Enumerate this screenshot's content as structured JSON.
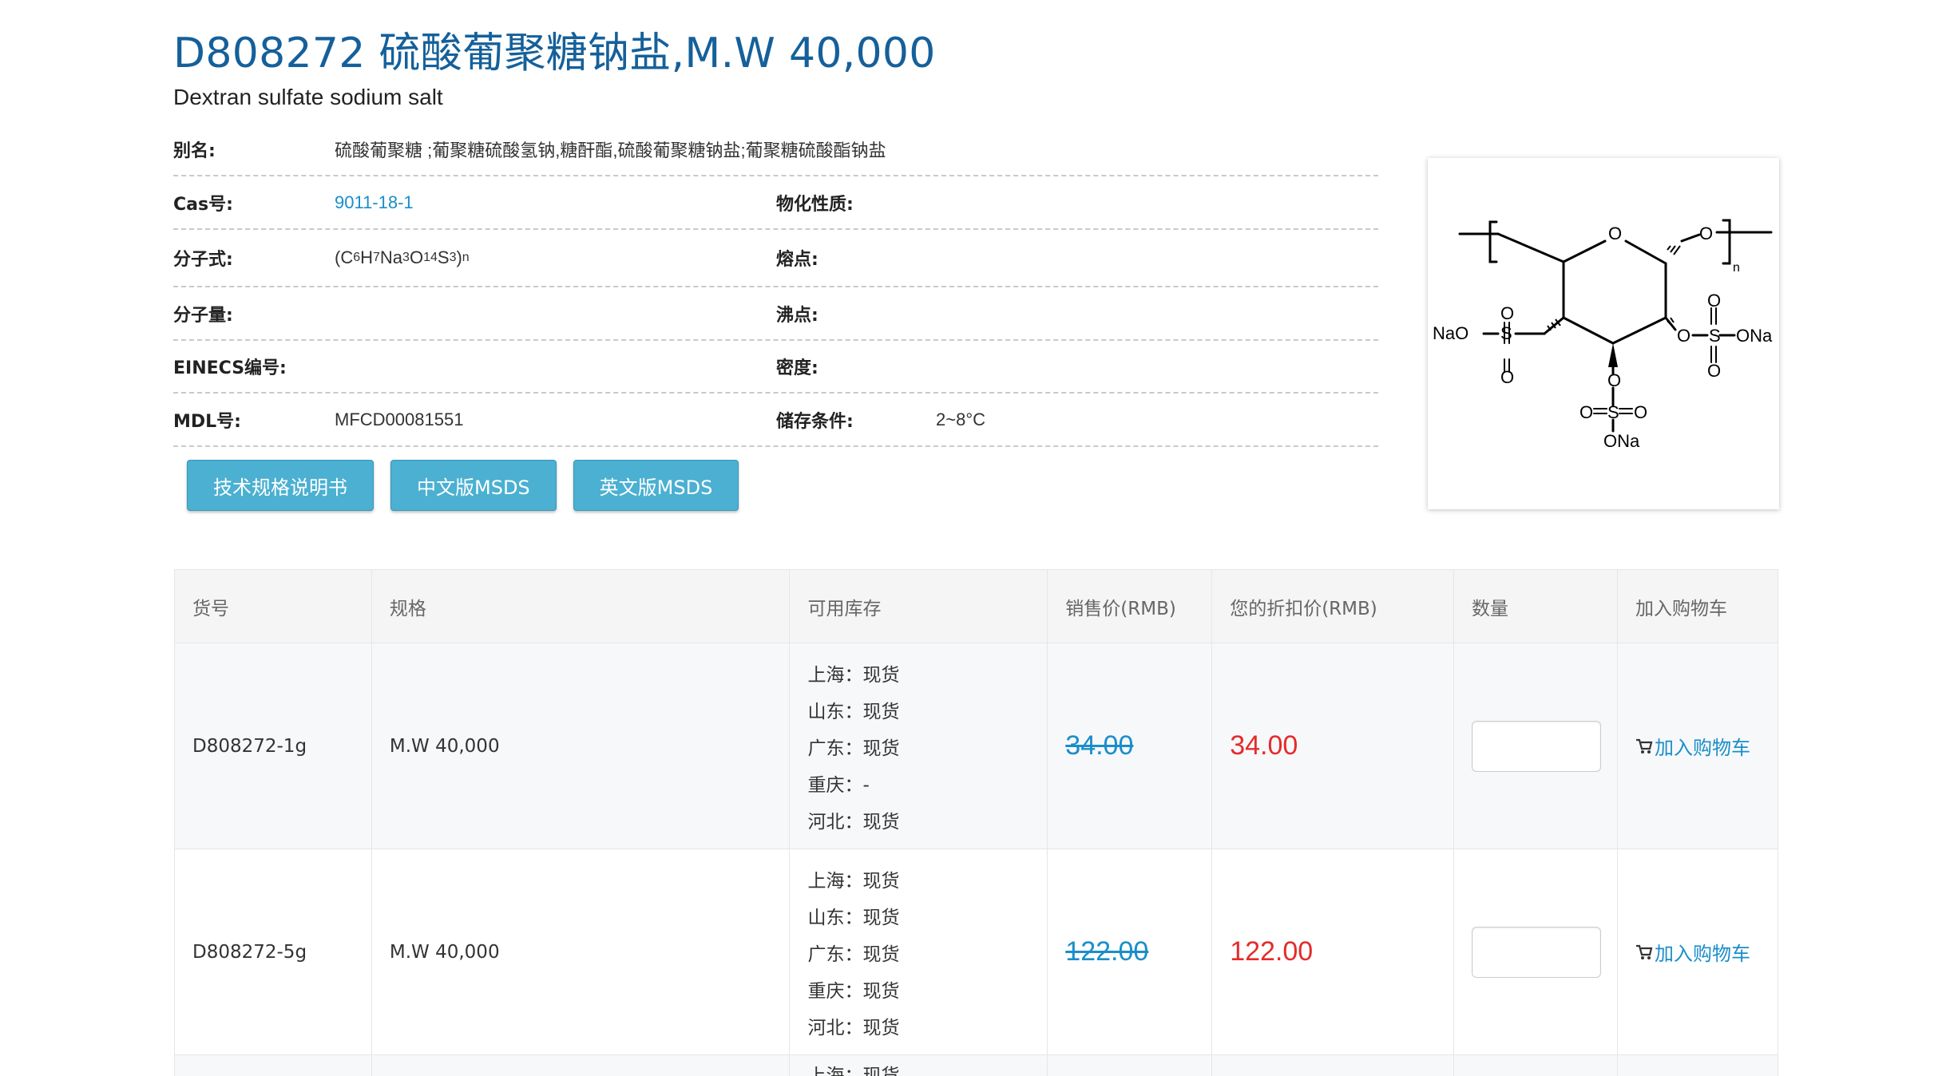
{
  "product": {
    "title": "D808272 硫酸葡聚糖钠盐,M.W 40,000",
    "subtitle": "Dextran sulfate sodium salt"
  },
  "properties": {
    "alias_label": "别名:",
    "alias_value": "硫酸葡聚糖 ;葡聚糖硫酸氢钠,糖酐酯,硫酸葡聚糖钠盐;葡聚糖硫酸酯钠盐",
    "cas_label": "Cas号:",
    "cas_value": "9011-18-1",
    "physchem_label": "物化性质:",
    "formula_label": "分子式:",
    "melting_label": "熔点:",
    "mw_label": "分子量:",
    "boiling_label": "沸点:",
    "einecs_label": "EINECS编号:",
    "density_label": "密度:",
    "mdl_label": "MDL号:",
    "mdl_value": "MFCD00081551",
    "storage_label": "储存条件:",
    "storage_value": "2~8°C"
  },
  "formula": {
    "p1": "(C",
    "s1": "6",
    "p2": "H",
    "s2": "7",
    "p3": "Na",
    "s3": "3",
    "p4": "O",
    "s4": "14",
    "p5": "S",
    "s5": "3",
    "p6": ")",
    "s6": "n"
  },
  "buttons": {
    "spec": "技术规格说明书",
    "msds_cn": "中文版MSDS",
    "msds_en": "英文版MSDS"
  },
  "structure_labels": {
    "ring_o": "O",
    "link_o": "O",
    "n": "n",
    "nao": "NaO",
    "s_left": "S",
    "o_top_left": "O",
    "o_bot_left": "O",
    "o_right_link": "O",
    "s_right": "S",
    "ona_right": "ONa",
    "o_top_right": "O",
    "o_bot_right": "O",
    "o_bottom_link": "O",
    "s_bottom": "S",
    "o_bl": "O",
    "o_br": "O",
    "ona_bottom": "ONa"
  },
  "table": {
    "headers": [
      "货号",
      "规格",
      "可用库存",
      "销售价(RMB)",
      "您的折扣价(RMB)",
      "数量",
      "加入购物车"
    ],
    "rows": [
      {
        "sku": "D808272-1g",
        "spec": "M.W 40,000",
        "stock": [
          "上海：现货",
          "山东：现货",
          "广东：现货",
          "重庆：-",
          "河北：现货"
        ],
        "price": "34.00",
        "discount": "34.00",
        "cart": "加入购物车"
      },
      {
        "sku": "D808272-5g",
        "spec": "M.W 40,000",
        "stock": [
          "上海：现货",
          "山东：现货",
          "广东：现货",
          "重庆：现货",
          "河北：现货"
        ],
        "price": "122.00",
        "discount": "122.00",
        "cart": "加入购物车"
      }
    ],
    "partial_stock": "上海：现货"
  },
  "colors": {
    "title": "#15609a",
    "link": "#1a8ec9",
    "button": "#4bb0d2",
    "price_red": "#e42b2b"
  }
}
